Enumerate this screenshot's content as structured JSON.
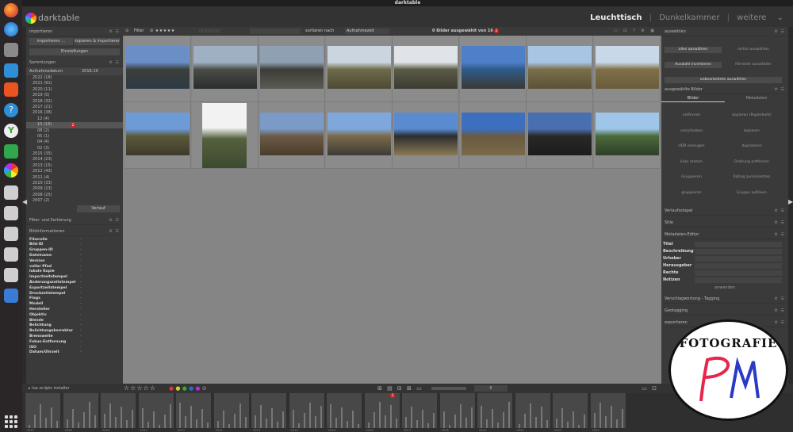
{
  "window": {
    "title": "darktable"
  },
  "app": {
    "logo_text": "darktable"
  },
  "views": {
    "active": "Leuchttisch",
    "items": [
      "Dunkelkammer",
      "weitere"
    ]
  },
  "left": {
    "import": {
      "title": "importieren",
      "btn_import": "importieren ...",
      "btn_copy": "kopieren & importieren ...",
      "btn_settings": "Einstellungen"
    },
    "collections": {
      "title": "Sammlungen",
      "filter_label": "Aufnahmedatum",
      "filter_value": "2016.10",
      "tree": [
        "2022 (18)",
        "2021 (91)",
        "2020 (11)",
        "2019 (5)",
        "2018 (32)",
        "2017 (21)",
        "2016 (38)",
        "12 (4)",
        "10 (16)",
        "08 (2)",
        "05 (1)",
        "04 (4)",
        "02 (3)",
        "2015 (35)",
        "2014 (23)",
        "2013 (15)",
        "2012 (43)",
        "2011 (4)",
        "2010 (33)",
        "2009 (23)",
        "2008 (25)",
        "2007 (2)"
      ],
      "history_btn": "Verlauf"
    },
    "filters": {
      "title": "Filter- und Sortierung"
    },
    "image_info": {
      "title": "Bildinformationen",
      "rows": [
        "Filmrolle",
        "Bild-ID",
        "Gruppen-ID",
        "Dateiname",
        "Version",
        "voller Pfad",
        "lokale Kopie",
        "Importzeitstempel",
        "Änderungszeitstempel",
        "Exportzeitstempel",
        "Druckzeitstempel",
        "Flags",
        "Modell",
        "Hersteller",
        "Objektiv",
        "Blende",
        "Belichtung",
        "Belichtungskorrektur",
        "Brennweite",
        "Fokus-Entfernung",
        "ISO",
        "Datum/Uhrzeit"
      ],
      "value": "-"
    },
    "lua": {
      "title": "lua scripts installer"
    }
  },
  "toolbar": {
    "filter_label": "Filter",
    "sort_label": "sortieren nach",
    "sort_value": "Aufnahmezeit",
    "status": "0 Bilder ausgewählt von 16",
    "badge": "2"
  },
  "right": {
    "select": {
      "title": "auswählen",
      "buttons": [
        "alles auswählen",
        "nichts auswählen",
        "Auswahl invertieren",
        "Filmrolle auswählen",
        "unbearbeitete auswählen"
      ]
    },
    "selected": {
      "title": "ausgewählte Bilder",
      "tab_images": "Bilder",
      "tab_metadata": "Metadaten",
      "actions": [
        "entfernen",
        "kopieren (Papierkorb)",
        "verschieben",
        "kopieren",
        "HDR erzeugen",
        "duplizieren",
        "links drehen",
        "Drehung entfernen",
        "Gruppieren",
        "Rating zurücksetzen",
        "gruppieren",
        "Gruppe auflösen"
      ]
    },
    "history_stack": {
      "title": "Verlaufsstapel"
    },
    "styles": {
      "title": "Stile"
    },
    "meta_editor": {
      "title": "Metadaten-Editor",
      "fields": [
        "Titel",
        "Beschreibung",
        "Urheber",
        "Herausgeber",
        "Rechte",
        "Notizen"
      ],
      "apply": "anwenden"
    },
    "tagging": {
      "title": "Verschlagwortung - Tagging"
    },
    "geotag": {
      "title": "Geotagging"
    },
    "export": {
      "title": "exportieren"
    }
  },
  "bottom": {
    "zoom_value": "8"
  },
  "timeline": {
    "labels": [
      "2007",
      "2008",
      "2009",
      "2010",
      "2011",
      "2012",
      "2013",
      "2014",
      "2015",
      "2016",
      "2017",
      "2018",
      "2019",
      "2020",
      "2021",
      "2022"
    ]
  },
  "watermark": {
    "text": "FOTOGRAFIE",
    "logo_letters": "PM"
  },
  "colors": {
    "panel": "#3a3a3a",
    "center": "#858585",
    "accent_red": "#d22222"
  }
}
